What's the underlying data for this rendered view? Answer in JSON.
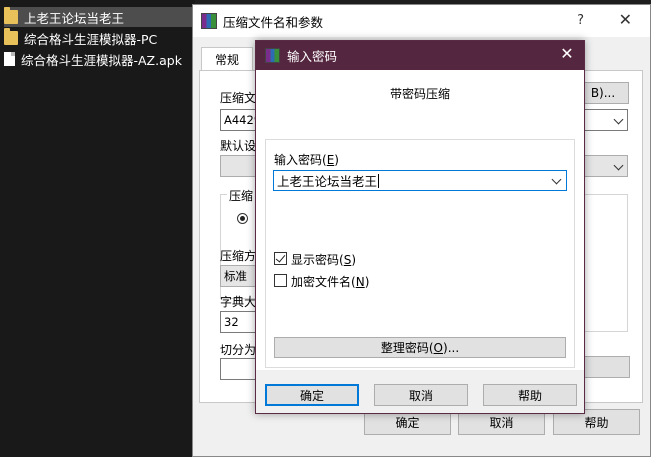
{
  "explorer": {
    "items": [
      {
        "name": "上老王论坛当老王",
        "kind": "folder"
      },
      {
        "name": "综合格斗生涯模拟器-PC",
        "kind": "folder"
      },
      {
        "name": "综合格斗生涯模拟器-AZ.apk",
        "kind": "file"
      }
    ]
  },
  "back_window": {
    "title": "压缩文件名和参数",
    "help": "?",
    "close": "✕",
    "tab_general": "常规",
    "archive_name_label": "压缩文",
    "archive_name_value": "A4429",
    "browse_label": "B)...",
    "default_profile_label": "默认设",
    "format_group_label": "压缩",
    "method_label": "压缩方",
    "method_value": "标准",
    "dict_label": "字典大",
    "dict_value": "32",
    "split_label": "切分为",
    "ok": "确定",
    "cancel": "取消",
    "help_btn": "帮助"
  },
  "password_dialog": {
    "title": "输入密码",
    "close": "✕",
    "heading": "带密码压缩",
    "enter_label": "输入密码",
    "enter_hotkey": "E",
    "password_value": "上老王论坛当老王",
    "show_password_label": "显示密码",
    "show_password_hotkey": "S",
    "show_password_checked": true,
    "encrypt_names_label": "加密文件名",
    "encrypt_names_hotkey": "N",
    "encrypt_names_checked": false,
    "manage_label": "整理密码",
    "manage_hotkey": "O",
    "manage_suffix": "...",
    "ok": "确定",
    "cancel": "取消",
    "help": "帮助"
  },
  "colors": {
    "explorer_bg": "#191919",
    "dialog_titlebar": "#55263f",
    "focus_blue": "#0078d7",
    "folder": "#e8c15a"
  }
}
